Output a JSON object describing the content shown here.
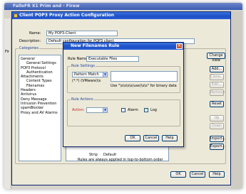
{
  "background_app": {
    "title": "FalloFR X1 Prim and - Firew",
    "side_label": "Fir"
  },
  "window": {
    "title": "Client POP3 Proxy Action Configuration",
    "name_label": "Name:",
    "name_value": "My POP3-Client",
    "description_label": "Description:",
    "description_value": "Default configuration for POP3 client",
    "categories_title": "Categories",
    "tree": [
      {
        "label": "General",
        "sub": false
      },
      {
        "label": "General Settings",
        "sub": true
      },
      {
        "label": "POP3 Protocol",
        "sub": false
      },
      {
        "label": "Authentication",
        "sub": true
      },
      {
        "label": "Attachments",
        "sub": false
      },
      {
        "label": "Content Types",
        "sub": true
      },
      {
        "label": "Filenames",
        "sub": true
      },
      {
        "label": "Headers",
        "sub": false
      },
      {
        "label": "Antivirus",
        "sub": false
      },
      {
        "label": "Deny Message",
        "sub": false
      },
      {
        "label": "Intrusion Prevention",
        "sub": false
      },
      {
        "label": "spamBlocker",
        "sub": false
      },
      {
        "label": "Proxy and AV Alarms",
        "sub": false
      }
    ],
    "change_view_label": "Change View",
    "side_buttons": {
      "add": "Add...",
      "clone": "Clone...",
      "edit": "Edit...",
      "remove": "Remove",
      "reset": "Reset",
      "up": "Up",
      "down": "Down",
      "import": "Import...",
      "export": "Export..."
    },
    "row_name": "Strip",
    "row_value": "Default",
    "footer_text": "Rules are always applied in top-to-bottom order",
    "ok_label": "OK",
    "cancel_label": "Cancel",
    "help_label": "Help"
  },
  "dialog": {
    "title": "New Filenames Rule",
    "rule_name_label": "Rule Name:",
    "rule_name_value": "Executable Files",
    "rule_settings_title": "Rule Settings",
    "match_type_value": "Pattern Match",
    "pattern_value": "(*.*) (VMware)\\s",
    "hint_text": "Use \"\\s\\s\\s\\s(use)\\s\\s\" for binary data",
    "rule_actions_title": "Rule Actions",
    "action_label": "Action:",
    "action_value": "",
    "alarm_label": "Alarm",
    "alarm_checked": false,
    "log_label": "Log",
    "log_checked": true,
    "ok_label": "OK",
    "cancel_label": "Cancel",
    "help_label": "Help"
  }
}
